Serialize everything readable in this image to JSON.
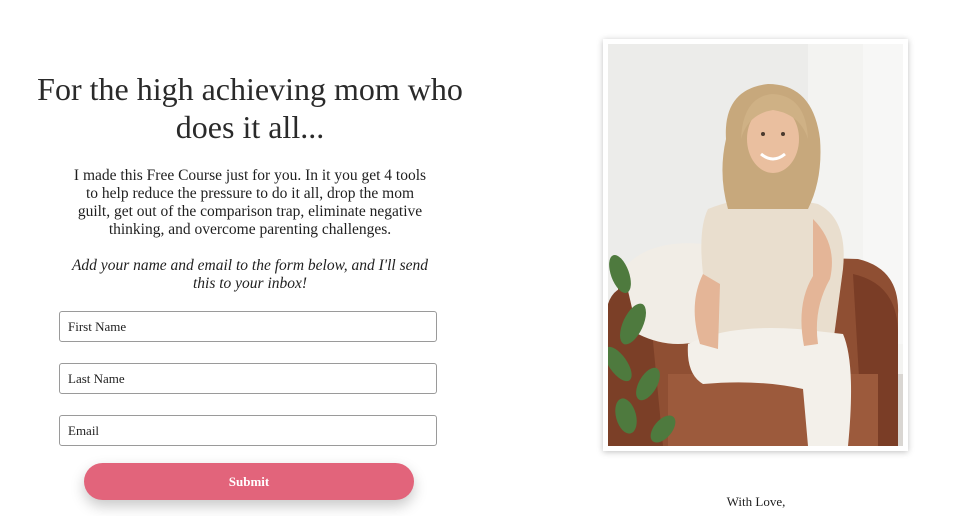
{
  "hero": {
    "headline": "For the high achieving mom who does it all...",
    "description": "I made this Free Course just for you. In it you get 4 tools to help reduce the pressure to do it all, drop the mom guilt, get out of the comparison trap, eliminate negative thinking, and overcome parenting challenges.",
    "cta_text": "Add your name and email to the form below, and I'll send this to your inbox!"
  },
  "form": {
    "first_name_placeholder": "First Name",
    "last_name_placeholder": "Last Name",
    "email_placeholder": "Email",
    "submit_label": "Submit"
  },
  "colors": {
    "accent": "#e2647b",
    "text": "#1f1f1f"
  },
  "photo": {
    "icon": "portrait-photo"
  },
  "signoff": {
    "text": "With Love,"
  }
}
